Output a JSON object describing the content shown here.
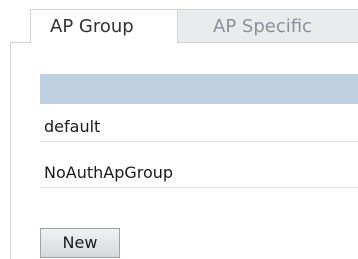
{
  "tabs": [
    {
      "label": "AP Group",
      "active": true
    },
    {
      "label": "AP Specific",
      "active": false
    }
  ],
  "table": {
    "header_color": "#bfd0e3",
    "rows": [
      {
        "name": "default"
      },
      {
        "name": "NoAuthApGroup"
      }
    ]
  },
  "actions": {
    "new_label": "New"
  }
}
